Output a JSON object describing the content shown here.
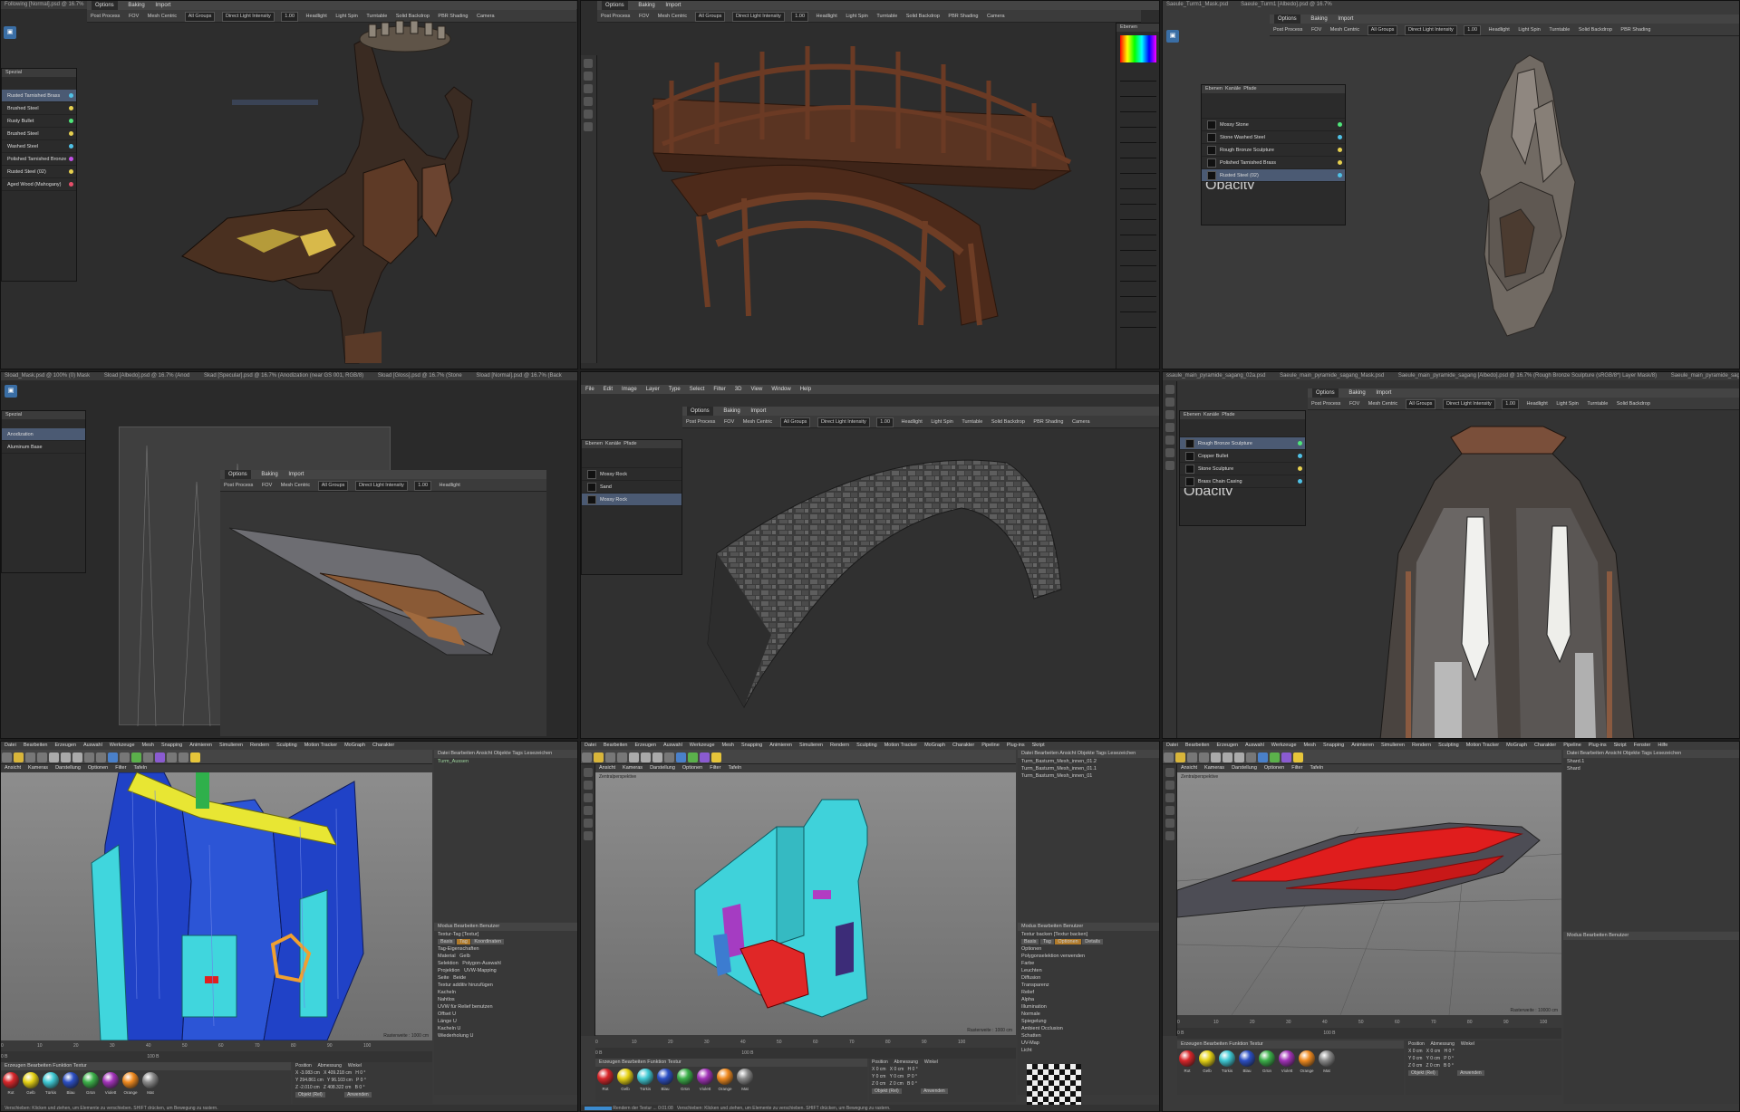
{
  "substance": {
    "menu": [
      "Options",
      "Baking",
      "Import"
    ],
    "options_bar": [
      "Post Process",
      "FOV",
      "Mesh Centric",
      "All Groups",
      "Direct Light Intensity",
      "1.00",
      "Headlight",
      "Light Spin",
      "Turntable",
      "Solid Backdrop",
      "PBR Shading",
      "Camera"
    ],
    "materials_panel_1": [
      "Rusted Tarnished Brass",
      "Brushed Steel",
      "Rusty Bullet",
      "Brushed Steel",
      "Washed Steel",
      "Polished Tarnished Bronze",
      "Rusted Steel (02)",
      "Aged Wood (Mahogany)"
    ],
    "materials_panel_2": [
      "Mossy Stone",
      "Stone Washed Steel",
      "Rough Bronze Sculpture",
      "Polished Tarnished Brass",
      "Rusted Steel (02)"
    ],
    "materials_panel_3": [
      "Anodization",
      "Aluminum Base"
    ],
    "materials_panel_4": [
      "Mossy Rock",
      "Sand",
      "Mossy Rock"
    ],
    "materials_panel_5": [
      "Rough Bronze Sculpture",
      "Copper Bullet",
      "Stone Sculpture",
      "Brass Chain Casing"
    ],
    "doc_tabs_4": [
      "Sload_Mask.psd @ 100% (0) Mask",
      "Sload [Albedo].psd @ 16.7% (Anod",
      "Skad [Specular].psd @ 16.7% (Anodization (near GS 001, RGB/8)",
      "Sload [Gloss].psd @ 16.7% (Stone",
      "Sload [Normal].psd @ 16.7% (Back"
    ],
    "doc_tabs_6": [
      "ssaule_main_pyramide_sagang_02a.psd",
      "Saeule_main_pyramide_sagang_Mask.psd",
      "Saeule_main_pyramide_sagang [Albedo].psd @ 16.7% (Rough Bronze Sculpture (sRGB/8*) Layer Mask/8)",
      "Saeule_main_pyramide_sagang [Specular].psd"
    ],
    "layer_tabs": [
      "Ebenen",
      "Kanäle",
      "Pfade"
    ],
    "opacity_label": "Opacity"
  },
  "c4d": {
    "menu_1": [
      "Datei",
      "Bearbeiten",
      "Erzeugen",
      "Auswahl",
      "Werkzeuge",
      "Mesh",
      "Snapping",
      "Animieren",
      "Simulieren",
      "Rendern",
      "Sculpting",
      "Motion Tracker",
      "MoGraph",
      "Charakter",
      "Pipeline",
      "Plug-ins",
      "Skript",
      "Fenster",
      "Hilfe"
    ],
    "viewport_menu": [
      "Ansicht",
      "Kameras",
      "Darstellung",
      "Optionen",
      "Filter",
      "Tafeln"
    ],
    "viewport_label": "Zentralperspektive",
    "grid_label_1": "Rasterweite : 1000 cm",
    "grid_label_2": "Rasterweite : 1000 cm",
    "grid_label_3": "Rasterweite : 10000 cm",
    "obj_menu": [
      "Datei",
      "Bearbeiten",
      "Ansicht",
      "Objekte",
      "Tags",
      "Lesezeichen"
    ],
    "objects_1": [
      "Turm_Aussen"
    ],
    "objects_2": [
      "Turm_Basturm_Mesh_innen_01.2",
      "Turm_Basturm_Mesh_innen_01.1",
      "Turm_Basturm_Mesh_innen_01"
    ],
    "objects_3": [
      "Shard.1",
      "Shard"
    ],
    "attr_menu": [
      "Modus",
      "Bearbeiten",
      "Benutzer"
    ],
    "attr_title_1": "Textur-Tag [Textur]",
    "attr_tabs_1": [
      "Basis",
      "Tag",
      "Koordinaten"
    ],
    "attr_rows_1": [
      "Tag-Eigenschaften",
      "Material",
      "Selektion",
      "Projektion",
      "Seite",
      "Textur additiv hinzufügen",
      "Kacheln",
      "Nahtlos",
      "UVW für Relief benutzen",
      "Offset U",
      "Länge U",
      "Kacheln U",
      "Wiederholung U"
    ],
    "attr_vals_1": [
      "Gelb",
      "Polygon-Auswahl",
      "UVW-Mapping",
      "Beide"
    ],
    "attr_title_2": "Textur backen [Textur backen]",
    "attr_tabs_2": [
      "Basis",
      "Tag",
      "Optionen",
      "Details"
    ],
    "attr_rows_2": [
      "Optionen",
      "Polygonselektion verwenden",
      "Farbe",
      "Leuchten",
      "Diffusion",
      "Transparenz",
      "Relief",
      "Alpha",
      "Illumination",
      "Normale",
      "Spiegelung",
      "Ambient Occlusion",
      "Schatten",
      "UV-Map",
      "Licht"
    ],
    "mat_menu": [
      "Erzeugen",
      "Bearbeiten",
      "Funktion",
      "Textur"
    ],
    "materials": [
      {
        "name": "Rot",
        "color": "#d8262a"
      },
      {
        "name": "Gelb",
        "color": "#e6d215"
      },
      {
        "name": "Türkis",
        "color": "#3fc9d4"
      },
      {
        "name": "Blau",
        "color": "#2c4fc4"
      },
      {
        "name": "Grün",
        "color": "#3cb04a"
      },
      {
        "name": "Violett",
        "color": "#a233b8"
      },
      {
        "name": "Orange",
        "color": "#f08a1f"
      },
      {
        "name": "Mat",
        "color": "#8a8a8a"
      }
    ],
    "coord_headers": [
      "Position",
      "Abmessung",
      "Winkel"
    ],
    "coord_rows_1": [
      [
        "X",
        "-3.083 cm",
        "X",
        "409.218 cm",
        "H",
        "0 °"
      ],
      [
        "Y",
        "294.861 cm",
        "Y",
        "96.103 cm",
        "P",
        "0 °"
      ],
      [
        "Z",
        "-2.010 cm",
        "Z",
        "408.322 cm",
        "B",
        "0 °"
      ]
    ],
    "coord_rows_2": [
      [
        "X",
        "0 cm",
        "X",
        "0 cm",
        "H",
        "0 °"
      ],
      [
        "Y",
        "0 cm",
        "Y",
        "0 cm",
        "P",
        "0 °"
      ],
      [
        "Z",
        "0 cm",
        "Z",
        "0 cm",
        "B",
        "0 °"
      ]
    ],
    "coord_mode": "Objekt (Rel)",
    "apply_button": "Anwenden",
    "timeline_frames": [
      "0",
      "10",
      "20",
      "30",
      "40",
      "50",
      "60",
      "70",
      "80",
      "90",
      "100"
    ],
    "frame_start": "0 B",
    "frame_end": "100 B",
    "status_1": "Verschieben: Klicken und ziehen, um Elemente zu verschieben. SHIFT drücken, um Bewegung zu rastern.",
    "status_2": "Rendern der Textur ...",
    "status_2_time": "0:01:08"
  }
}
